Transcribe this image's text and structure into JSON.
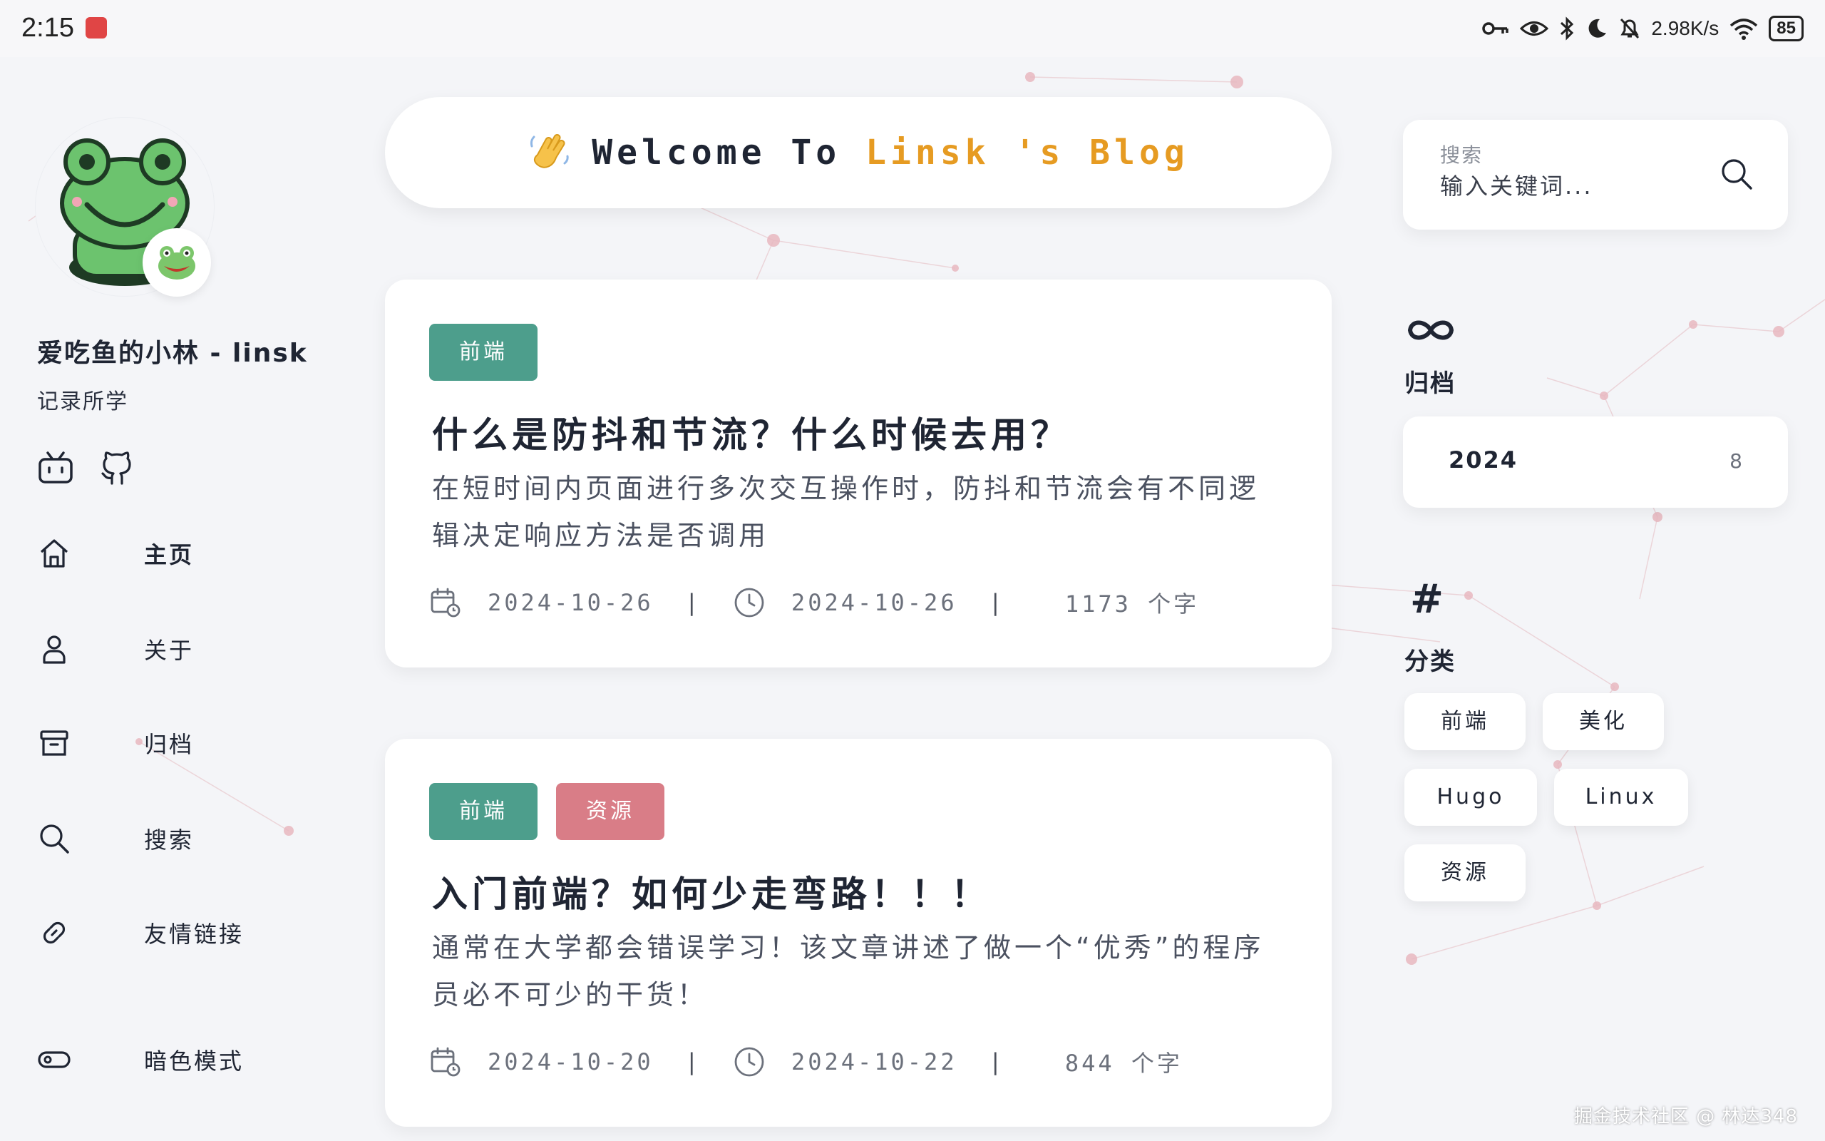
{
  "status_bar": {
    "time": "2:15",
    "net_speed": "2.98K/s",
    "battery": "85"
  },
  "sidebar": {
    "site_title": "爱吃鱼的小林 - linsk",
    "subtitle": "记录所学",
    "nav": [
      {
        "label": "主页",
        "icon": "home-icon"
      },
      {
        "label": "关于",
        "icon": "user-icon"
      },
      {
        "label": "归档",
        "icon": "archive-icon"
      },
      {
        "label": "搜索",
        "icon": "search-icon"
      },
      {
        "label": "友情链接",
        "icon": "link-icon"
      }
    ],
    "dark_mode_label": "暗色模式"
  },
  "welcome": {
    "prefix": "Welcome To ",
    "highlight": "Linsk 's Blog"
  },
  "posts": [
    {
      "tags": [
        "前端"
      ],
      "title": "什么是防抖和节流？什么时候去用？",
      "description": "在短时间内页面进行多次交互操作时，防抖和节流会有不同逻辑决定响应方法是否调用",
      "created": "2024-10-26",
      "updated": "2024-10-26",
      "words": "1173 个字"
    },
    {
      "tags": [
        "前端",
        "资源"
      ],
      "title": "入门前端？如何少走弯路！！！",
      "description": "通常在大学都会错误学习！该文章讲述了做一个“优秀”的程序员必不可少的干货！",
      "created": "2024-10-20",
      "updated": "2024-10-22",
      "words": "844 个字"
    }
  ],
  "right": {
    "search_label": "搜索",
    "search_placeholder": "输入关键词...",
    "archive_title": "归档",
    "archive_year": "2024",
    "archive_count": "8",
    "category_title": "分类",
    "categories": [
      "前端",
      "美化",
      "Hugo",
      "Linux",
      "资源"
    ]
  },
  "colors": {
    "tag_green": "#4d9e8c",
    "tag_pink": "#d97d87",
    "welcome_highlight": "#e69b22"
  },
  "watermark": "掘金技术社区 @ 林达348"
}
